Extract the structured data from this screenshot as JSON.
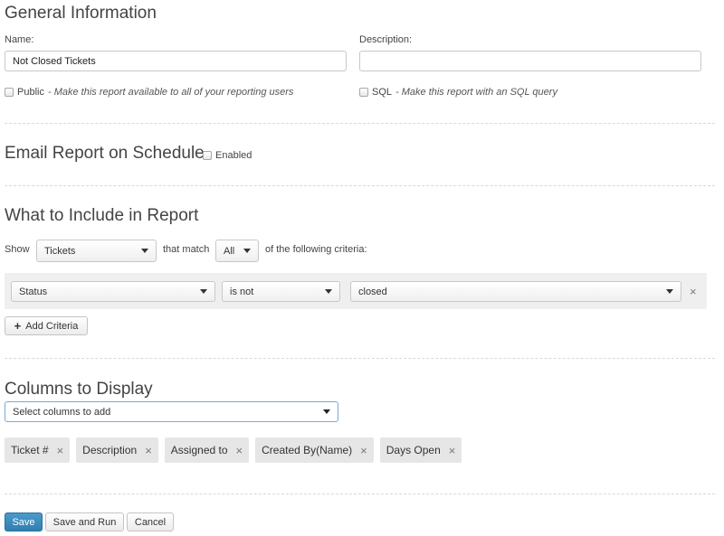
{
  "general": {
    "title": "General Information",
    "name_label": "Name:",
    "name_value": "Not Closed Tickets",
    "description_label": "Description:",
    "description_value": "",
    "public_label": "Public",
    "public_hint": "- Make this report available to all of your reporting users",
    "sql_label": "SQL",
    "sql_hint": "- Make this report with an SQL query"
  },
  "email": {
    "title": "Email Report on Schedule",
    "enabled_label": "Enabled"
  },
  "include": {
    "title": "What to Include in Report",
    "show_label": "Show",
    "show_value": "Tickets",
    "match_label": "that match",
    "match_value": "All",
    "criteria_suffix": "of the following criteria:",
    "criteria": [
      {
        "field": "Status",
        "operator": "is not",
        "value": "closed"
      }
    ],
    "add_criteria_label": "Add Criteria"
  },
  "columns": {
    "title": "Columns to Display",
    "select_placeholder": "Select columns to add",
    "tags": [
      "Ticket #",
      "Description",
      "Assigned to",
      "Created By(Name)",
      "Days Open"
    ]
  },
  "actions": {
    "save": "Save",
    "save_and_run": "Save and Run",
    "cancel": "Cancel"
  },
  "icons": {
    "remove": "×",
    "add": "+"
  }
}
